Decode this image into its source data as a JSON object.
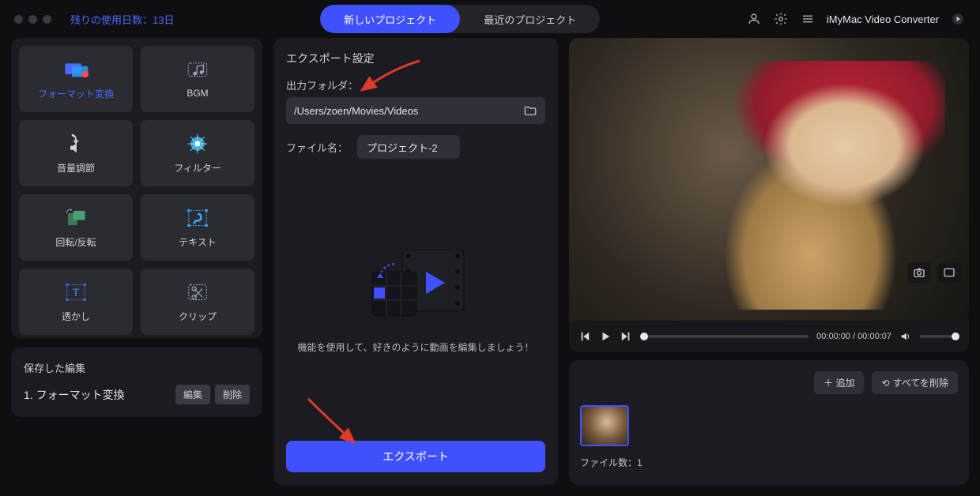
{
  "header": {
    "trial_label": "残りの使用日数：13日",
    "tab_new": "新しいプロジェクト",
    "tab_recent": "最近のプロジェクト",
    "app_name": "iMyMac Video Converter"
  },
  "tools": [
    {
      "id": "format-convert",
      "label": "フォーマット変換",
      "active": true
    },
    {
      "id": "bgm",
      "label": "BGM",
      "active": false
    },
    {
      "id": "volume",
      "label": "音量調節",
      "active": false
    },
    {
      "id": "filter",
      "label": "フィルター",
      "active": false
    },
    {
      "id": "rotate",
      "label": "回転/反転",
      "active": false
    },
    {
      "id": "text",
      "label": "テキスト",
      "active": false
    },
    {
      "id": "watermark",
      "label": "透かし",
      "active": false
    },
    {
      "id": "clip",
      "label": "クリップ",
      "active": false
    }
  ],
  "saved": {
    "title": "保存した編集",
    "item_label": "1.  フォーマット変換",
    "edit_btn": "編集",
    "delete_btn": "削除"
  },
  "export": {
    "title": "エクスポート設定",
    "output_folder_label": "出力フォルダ：",
    "output_folder_value": "/Users/zoen/Movies/Videos",
    "filename_label": "ファイル名：",
    "filename_value": "プロジェクト-2",
    "hint": "機能を使用して、好きのように動画を編集しましょう！",
    "export_btn": "エクスポート"
  },
  "player": {
    "time_current": "00:00:00",
    "time_total": "00:00:07"
  },
  "files": {
    "add_btn": "＋ 追加",
    "delete_all_btn": "すべてを削除",
    "delete_all_icon": "⟲",
    "count_label": "ファイル数：1"
  }
}
